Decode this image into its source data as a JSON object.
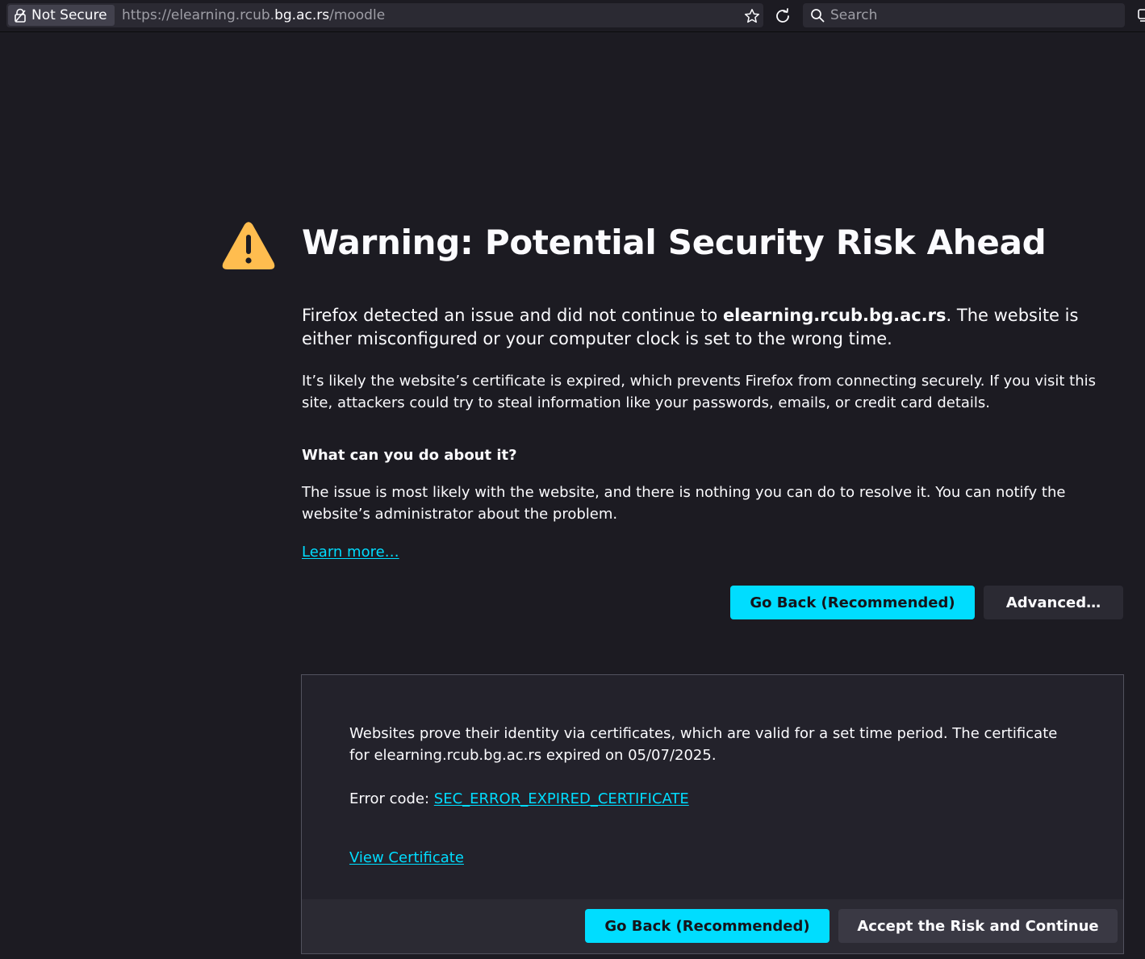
{
  "browser": {
    "identity_label": "Not Secure",
    "url_prefix": "https://elearning.rcub.",
    "url_domain": "bg.ac.rs",
    "url_suffix": "/moodle",
    "search_placeholder": "Search"
  },
  "error_page": {
    "title": "Warning: Potential Security Risk Ahead",
    "intro_before": "Firefox detected an issue and did not continue to ",
    "intro_host": "elearning.rcub.bg.ac.rs",
    "intro_after": ". The website is either misconfigured or your computer clock is set to the wrong time.",
    "explanation": "It’s likely the website’s certificate is expired, which prevents Firefox from connecting securely. If you visit this site, attackers could try to steal information like your passwords, emails, or credit card details.",
    "what_heading": "What can you do about it?",
    "what_text": "The issue is most likely with the website, and there is nothing you can do to resolve it. You can notify the website’s administrator about the problem.",
    "learn_more": "Learn more…",
    "go_back_label": "Go Back (Recommended)",
    "advanced_label": "Advanced…"
  },
  "advanced_panel": {
    "text": "Websites prove their identity via certificates, which are valid for a set time period. The certificate for elearning.rcub.bg.ac.rs expired on 05/07/2025.",
    "error_code_label": "Error code: ",
    "error_code": "SEC_ERROR_EXPIRED_CERTIFICATE",
    "view_certificate": "View Certificate",
    "go_back_label": "Go Back (Recommended)",
    "accept_label": "Accept the Risk and Continue"
  },
  "colors": {
    "background": "#1c1b22",
    "accent": "#00ddff",
    "warning_icon": "#ffbd4f",
    "panel_background": "#23222b"
  },
  "icons": {
    "identity": "lock-warning-icon",
    "bookmark": "star-icon",
    "reload": "reload-icon",
    "search": "search-icon",
    "warning": "warning-triangle-icon"
  }
}
